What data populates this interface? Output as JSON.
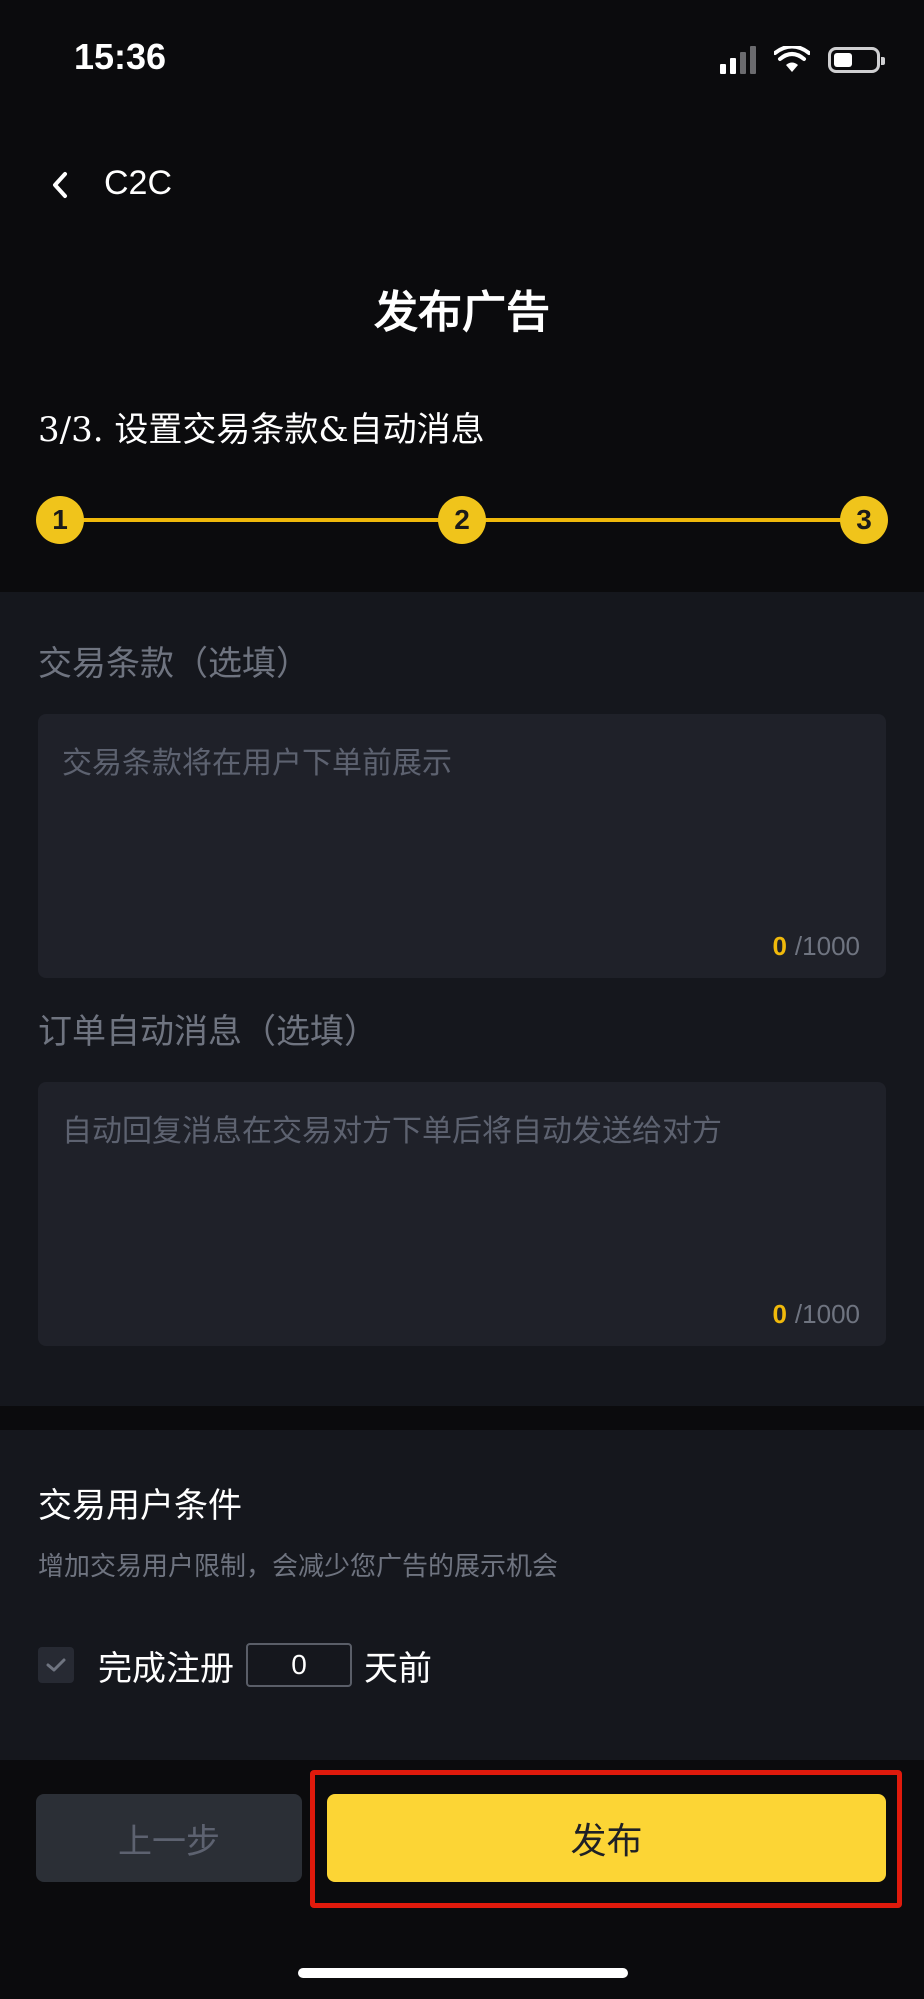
{
  "status_bar": {
    "time": "15:36",
    "signal_icon": "signal-icon",
    "wifi_icon": "wifi-icon",
    "battery_icon": "battery-icon"
  },
  "nav": {
    "back_icon": "chevron-left-icon",
    "back_label": "C2C"
  },
  "page_title": "发布广告",
  "stepper": {
    "caption": "3/3. 设置交易条款&自动消息",
    "steps": [
      "1",
      "2",
      "3"
    ],
    "current_step": 3,
    "accent_color": "#f0b90b"
  },
  "trade_terms": {
    "label": "交易条款（选填）",
    "placeholder": "交易条款将在用户下单前展示",
    "count": "0",
    "max": "/1000"
  },
  "auto_message": {
    "label": "订单自动消息（选填）",
    "placeholder": "自动回复消息在交易对方下单后将自动发送给对方",
    "count": "0",
    "max": "/1000"
  },
  "user_conditions": {
    "title": "交易用户条件",
    "subtitle": "增加交易用户限制，会减少您广告的展示机会",
    "registered": {
      "prefix": "完成注册",
      "value": "0",
      "suffix": "天前",
      "checked": true
    }
  },
  "footer": {
    "prev_label": "上一步",
    "publish_label": "发布",
    "publish_color": "#fcd535",
    "highlight_color": "#e01a0c"
  }
}
